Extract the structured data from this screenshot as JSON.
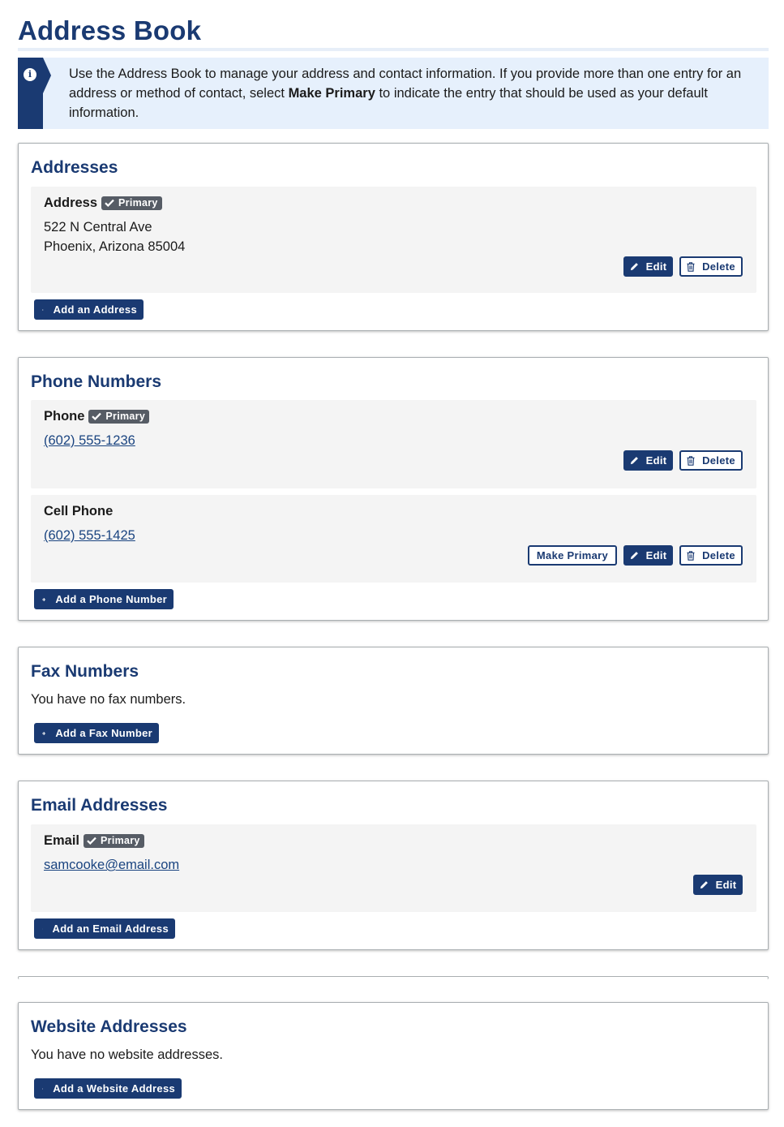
{
  "page": {
    "title": "Address Book"
  },
  "alert": {
    "text_before": "Use the Address Book to manage your address and contact information. If you provide more than one entry for an address or method of contact, select ",
    "text_bold": "Make Primary",
    "text_after": " to indicate the entry that should be used as your default information."
  },
  "badges": {
    "primary": "Primary"
  },
  "buttons": {
    "edit": "Edit",
    "delete": "Delete",
    "make_primary": "Make Primary"
  },
  "addresses": {
    "title": "Addresses",
    "entries": [
      {
        "label": "Address",
        "primary": true,
        "line1": "522 N Central Ave",
        "line2": "Phoenix, Arizona 85004"
      }
    ],
    "add_label": "Add an Address"
  },
  "phones": {
    "title": "Phone Numbers",
    "entries": [
      {
        "label": "Phone",
        "primary": true,
        "value": "(602) 555-1236"
      },
      {
        "label": "Cell Phone",
        "primary": false,
        "value": "(602) 555-1425"
      }
    ],
    "add_label": "Add a Phone Number"
  },
  "fax": {
    "title": "Fax Numbers",
    "empty_text": "You have no fax numbers.",
    "add_label": "Add a Fax Number"
  },
  "emails": {
    "title": "Email Addresses",
    "entries": [
      {
        "label": "Email",
        "primary": true,
        "value": "samcooke@email.com"
      }
    ],
    "add_label": "Add an Email Address"
  },
  "websites": {
    "title": "Website Addresses",
    "empty_text": "You have no website addresses.",
    "add_label": "Add a Website Address"
  },
  "icons": {
    "info": "info-icon",
    "check": "check-icon",
    "edit": "pencil-icon",
    "delete": "trash-icon",
    "add": "plus-icon"
  },
  "colors": {
    "primary": "#1a3a72",
    "badge": "#565c65",
    "entry_bg": "#f4f4f4",
    "alert_bg": "#e6f0fc",
    "link": "#1a4480"
  }
}
